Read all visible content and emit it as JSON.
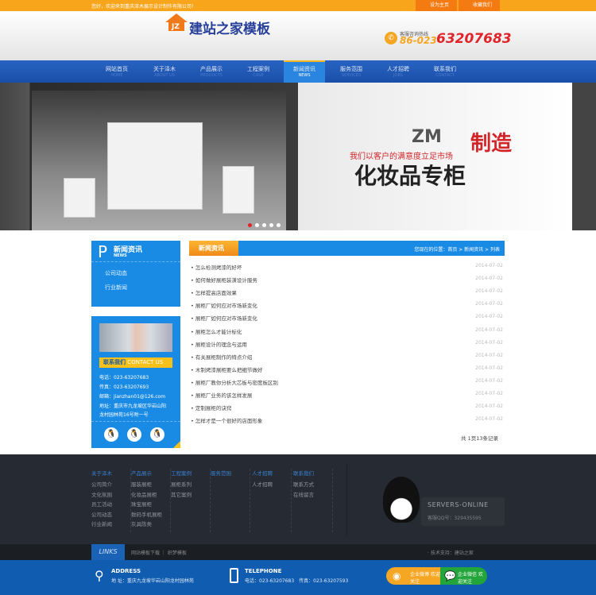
{
  "topbar": {
    "welcome": "您好，欢迎来到重庆泽木展示设计制作有限公司！",
    "set_home": "设为主页",
    "favorite": "收藏我们"
  },
  "header": {
    "logo_text": "建站之家模板",
    "logo_badge": "JZ",
    "hotline_label": "客服咨询热线",
    "phone_prefix": "86-023-",
    "phone_number": "63207683"
  },
  "nav": [
    {
      "label": "网站首页",
      "en": "HOME"
    },
    {
      "label": "关于泽木",
      "en": "ABOUT US"
    },
    {
      "label": "产品展示",
      "en": "PRODUCTS"
    },
    {
      "label": "工程案例",
      "en": "CASE"
    },
    {
      "label": "新闻资讯",
      "en": "NEWS"
    },
    {
      "label": "服务范围",
      "en": "SERVICES"
    },
    {
      "label": "人才招聘",
      "en": "JOBS"
    },
    {
      "label": "联系我们",
      "en": "CONTACT"
    }
  ],
  "banner": {
    "logo": "ZM",
    "slogan": "我们以客户的满意度立足市场",
    "title": "化妆品专柜",
    "red_text": "制造"
  },
  "sidebar": {
    "title": "新闻资讯",
    "title_en": "NEWS",
    "links": [
      "公司动态",
      "行业新闻"
    ]
  },
  "contact": {
    "bar_cn": "联系我们",
    "bar_en": "CONTACT US",
    "lines": [
      "电话：023-63207683",
      "传真：023-63207693",
      "邮箱：jianzhan01@126.com",
      "地址：重庆市九龙坡区华岩山阳",
      "龙村园林苑16号附一号"
    ]
  },
  "main": {
    "tab": "新闻资讯",
    "breadcrumb": "您现在的位置：首页 > 新闻资讯 > 列表",
    "news": [
      {
        "title": "怎么检测烤漆的好坏",
        "date": "2014-07-02"
      },
      {
        "title": "如何做好展柜装潢设计服务",
        "date": "2014-07-02"
      },
      {
        "title": "怎样提高店面效果",
        "date": "2014-07-02"
      },
      {
        "title": "展柜厂如何应对市场新变化",
        "date": "2014-07-02"
      },
      {
        "title": "展柜厂如何应对市场新变化",
        "date": "2014-07-02"
      },
      {
        "title": "展柜怎么才能计标化",
        "date": "2014-07-02"
      },
      {
        "title": "展柜设计的理念与运用",
        "date": "2014-07-02"
      },
      {
        "title": "有关展柜制作的特点介绍",
        "date": "2014-07-02"
      },
      {
        "title": "木制烤漆展柜要么把细节做好",
        "date": "2014-07-02"
      },
      {
        "title": "展柜厂教你分析大芯板与密度板区别",
        "date": "2014-07-02"
      },
      {
        "title": "展柜厂业务的该怎样发展",
        "date": "2014-07-02"
      },
      {
        "title": "定制展柜的诀窍",
        "date": "2014-07-02"
      },
      {
        "title": "怎样才是一个很好的店面形象",
        "date": "2014-07-02"
      }
    ],
    "pager": "共 1页13条记录"
  },
  "footer": {
    "columns": [
      {
        "head": "关于泽木",
        "links": [
          "公司简介",
          "文化氛围",
          "员工活动",
          "公司动态",
          "行业新闻"
        ]
      },
      {
        "head": "产品展示",
        "links": [
          "服装展柜",
          "化妆品展柜",
          "珠宝展柜",
          "数码手机展柜",
          "灰具陈类"
        ]
      },
      {
        "head": "工程案例",
        "links": [
          "展柜系列",
          "其它案例"
        ]
      },
      {
        "head": "服务范围",
        "links": []
      },
      {
        "head": "人才招聘",
        "links": [
          "人才招聘"
        ]
      },
      {
        "head": "联系我们",
        "links": [
          "联系方式",
          "在线留言"
        ]
      }
    ],
    "online_title": "SERVERS-ONLINE",
    "online_qq": "客服QQ号：329435595"
  },
  "links": {
    "label": "LINKS",
    "items": "网站模板下载 ｜ 织梦模板",
    "support": "· 技术支持：建站之家"
  },
  "bottom": {
    "address_head": "ADDRESS",
    "address": "地 址：重庆九龙坡华岩山阳龙村园林苑",
    "tel_head": "TELEPHONE",
    "tel": "电话：023-63207683　传真：023-63207593",
    "weibo": "企业微博 欢迎关注",
    "wechat": "企业微信 欢迎关注"
  }
}
